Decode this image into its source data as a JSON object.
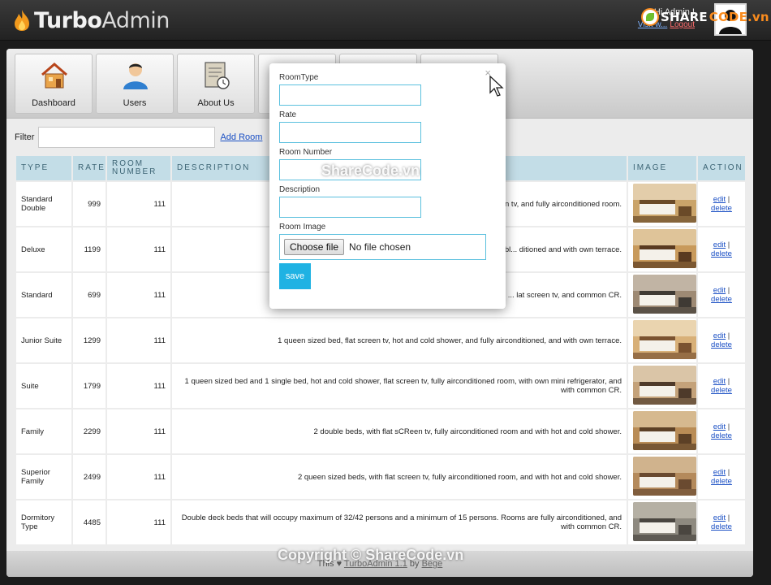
{
  "app": {
    "logo_bold": "Turbo",
    "logo_light": "Admin"
  },
  "user": {
    "greeting": "Hi Admin !",
    "visit_label": "Visit w...",
    "logout_label": "Logout"
  },
  "watermark": {
    "brand_left": "SHARE",
    "brand_right": "CODE.vn",
    "center_text": "ShareCode.vn",
    "footer_text": "Copyright © ShareCode.vn"
  },
  "nav": {
    "items": [
      {
        "label": "Dashboard"
      },
      {
        "label": "Users"
      },
      {
        "label": "About Us"
      }
    ]
  },
  "filter": {
    "label": "Filter",
    "value": "",
    "add_room_label": "Add Room"
  },
  "table": {
    "headers": [
      "TYPE",
      "RATE",
      "ROOM NUMBER",
      "DESCRIPTION",
      "IMAGE",
      "ACTION"
    ],
    "rows": [
      {
        "type": "Standard Double",
        "rate": "999",
        "room_number": "111",
        "description": "1 single bed and 1 pu... een tv, and fully airconditioned room."
      },
      {
        "type": "Deluxe",
        "rate": "1199",
        "room_number": "111",
        "description": "1 doubl... ditioned and with own terrace."
      },
      {
        "type": "Standard",
        "rate": "699",
        "room_number": "111",
        "description": "... lat screen tv, and common CR."
      },
      {
        "type": "Junior Suite",
        "rate": "1299",
        "room_number": "111",
        "description": "1 queen sized bed, flat screen tv, hot and cold shower, and fully airconditioned, and with own terrace."
      },
      {
        "type": "Suite",
        "rate": "1799",
        "room_number": "111",
        "description": "1 queen sized bed and 1 single bed, hot and cold shower, flat screen tv, fully airconditioned room, with own mini refrigerator, and with common CR."
      },
      {
        "type": "Family",
        "rate": "2299",
        "room_number": "111",
        "description": "2 double beds, with flat sCReen tv, fully airconditioned room and with hot and cold shower."
      },
      {
        "type": "Superior Family",
        "rate": "2499",
        "room_number": "111",
        "description": "2 queen sized beds, with flat screen tv, fully airconditioned room, and with hot and cold shower."
      },
      {
        "type": "Dormitory Type",
        "rate": "4485",
        "room_number": "111",
        "description": "Double deck beds that will occupy maximum of 32/42 persons and a minimum of 15 persons. Rooms are fully airconditioned, and with common CR."
      }
    ],
    "edit_label": "edit",
    "delete_label": "delete",
    "action_sep": "|"
  },
  "modal": {
    "close_label": "×",
    "fields": [
      {
        "label": "RoomType",
        "value": ""
      },
      {
        "label": "Rate",
        "value": ""
      },
      {
        "label": "Room Number",
        "value": ""
      },
      {
        "label": "Description",
        "value": ""
      }
    ],
    "image_label": "Room Image",
    "choose_file_label": "Choose file",
    "no_file_label": "No file chosen",
    "save_label": "save"
  },
  "footer": {
    "prefix": "This",
    "link_label": "TurboAdmin 1.1",
    "by": "by",
    "author": "Bege"
  },
  "colors": {
    "header_cell": "#c3dde7",
    "save_button": "#1fb2e3",
    "link": "#1a4fc4",
    "input_border": "#5bc0de"
  }
}
